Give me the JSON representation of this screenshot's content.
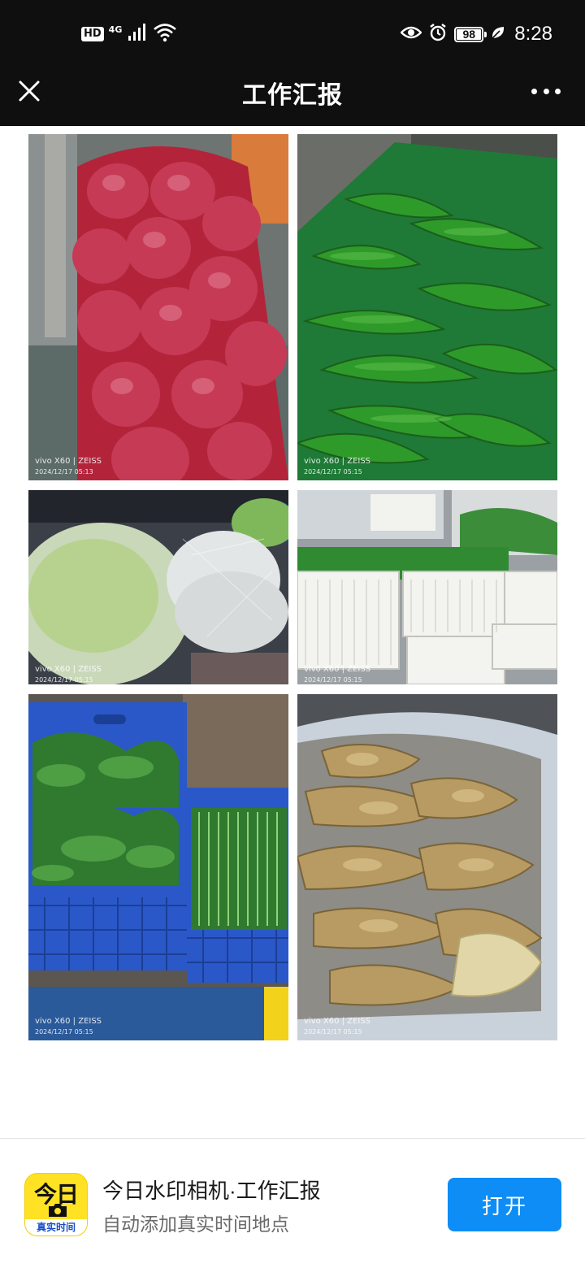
{
  "status_bar": {
    "hd": "HD",
    "network": "4G",
    "battery": "98",
    "battery_level": 0.98,
    "time": "8:28"
  },
  "nav": {
    "title": "工作汇报",
    "close_icon": "close-icon",
    "more_icon": "more-icon"
  },
  "photos": [
    {
      "subject": "onions",
      "watermark_brand": "vivo X60 | ZEISS",
      "watermark_date": "2024/12/17 05:13"
    },
    {
      "subject": "green peppers",
      "watermark_brand": "vivo X60 | ZEISS",
      "watermark_date": "2024/12/17 05:15"
    },
    {
      "subject": "cabbage",
      "watermark_brand": "vivo X60 | ZEISS",
      "watermark_date": "2024/12/17 05:15"
    },
    {
      "subject": "bok choy in crates",
      "watermark_brand": "vivo X60 | ZEISS",
      "watermark_date": "2024/12/17 05:15"
    },
    {
      "subject": "leafy greens in blue crates",
      "watermark_brand": "vivo X60 | ZEISS",
      "watermark_date": "2024/12/17 05:15"
    },
    {
      "subject": "ginger",
      "watermark_brand": "vivo X60 | ZEISS",
      "watermark_date": "2024/12/17 05:15"
    }
  ],
  "banner": {
    "icon_top_text": "今日",
    "icon_bottom_text": "真实时间",
    "app_name": "今日水印相机·工作汇报",
    "app_desc": "自动添加真实时间地点",
    "open_label": "打开",
    "colors": {
      "button": "#0d8df5",
      "icon_bg": "#ffe224"
    }
  }
}
